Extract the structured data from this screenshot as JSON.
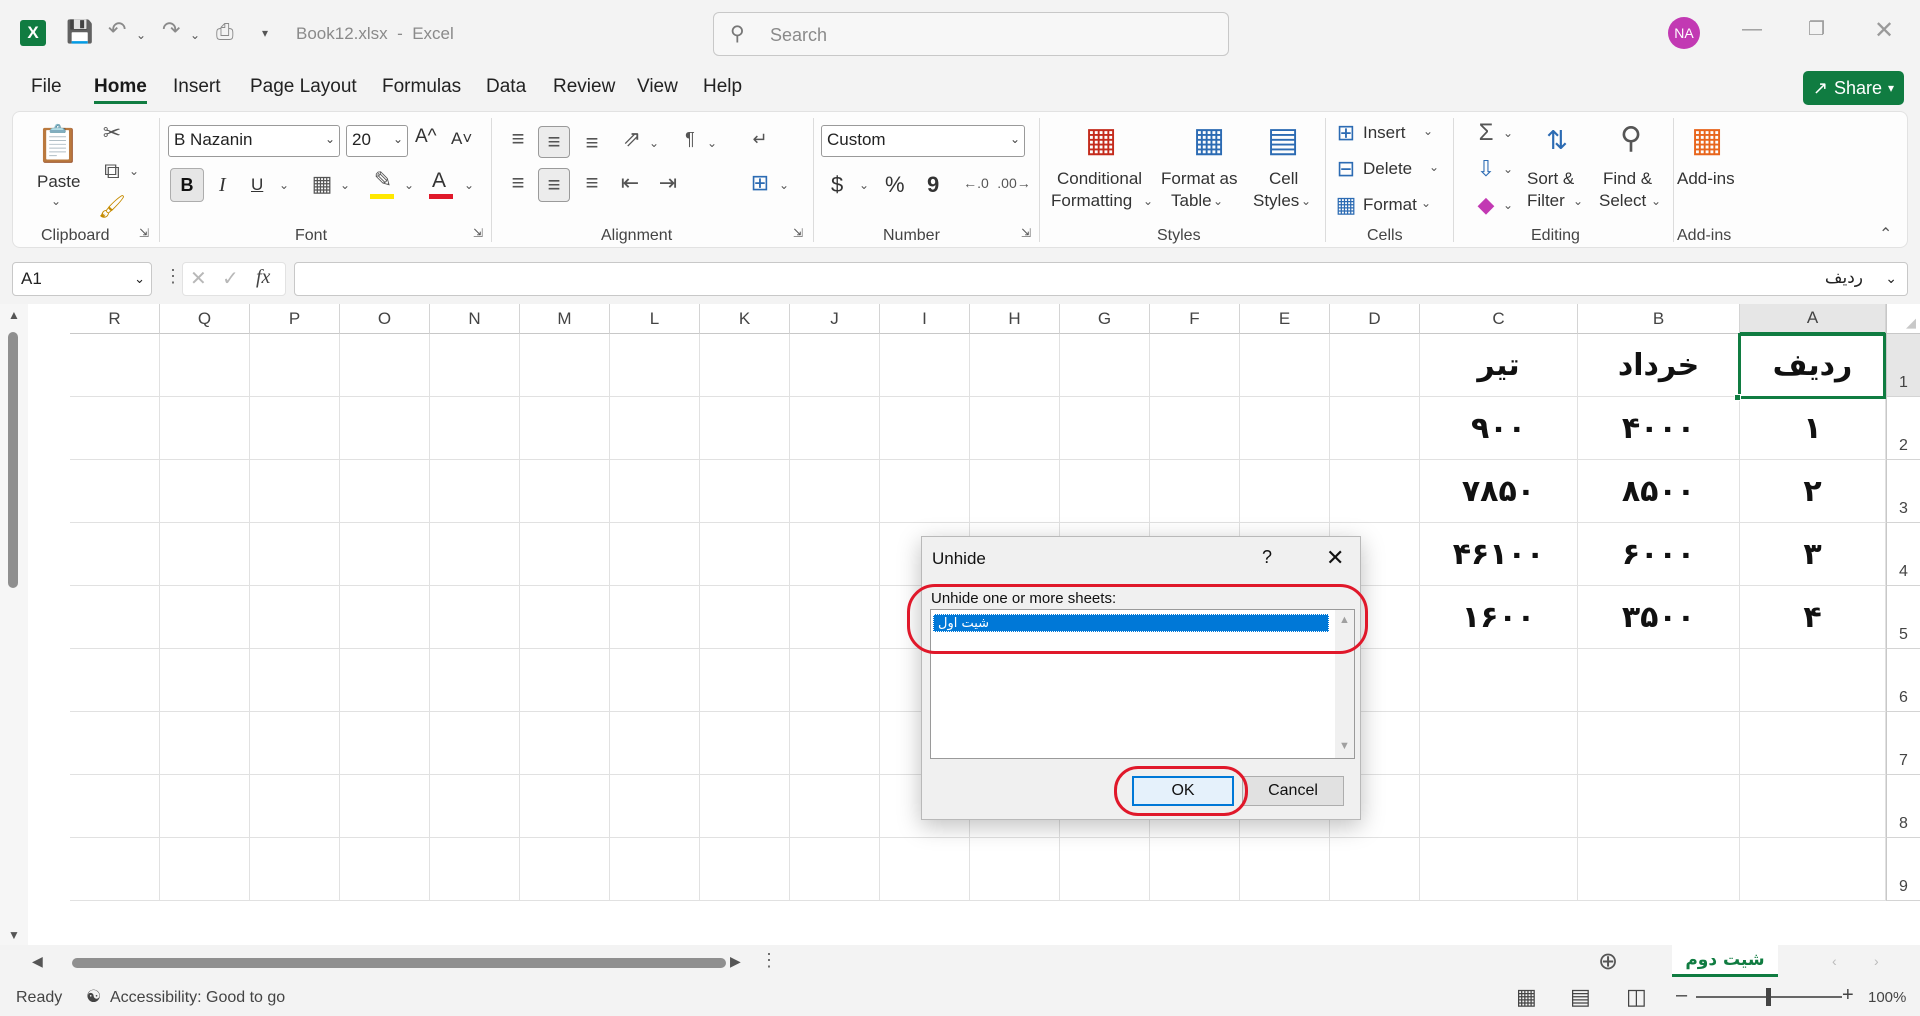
{
  "titlebar": {
    "file_title": "Book12.xlsx  -  Excel",
    "search_placeholder": "Search",
    "avatar_initials": "NA",
    "app_icon": "excel-icon"
  },
  "menu": {
    "items": [
      "File",
      "Home",
      "Insert",
      "Page Layout",
      "Formulas",
      "Data",
      "Review",
      "View",
      "Help"
    ],
    "active": "Home",
    "share_label": "Share"
  },
  "ribbon": {
    "clipboard": {
      "paste": "Paste",
      "label": "Clipboard"
    },
    "font": {
      "name": "B Nazanin",
      "size": "20",
      "label": "Font",
      "bold": "B",
      "italic": "I",
      "underline": "U",
      "grow": "A^",
      "shrink": "A˅"
    },
    "alignment": {
      "label": "Alignment"
    },
    "number": {
      "format": "Custom",
      "currency": "$",
      "percent": "%",
      "comma": "9",
      "label": "Number"
    },
    "styles": {
      "cond_fmt_1": "Conditional",
      "cond_fmt_2": "Formatting",
      "fmt_table_1": "Format as",
      "fmt_table_2": "Table",
      "cell_styles_1": "Cell",
      "cell_styles_2": "Styles",
      "label": "Styles"
    },
    "cells": {
      "insert": "Insert",
      "delete": "Delete",
      "format": "Format",
      "label": "Cells"
    },
    "editing": {
      "sort_1": "Sort &",
      "sort_2": "Filter",
      "find_1": "Find &",
      "find_2": "Select",
      "label": "Editing"
    },
    "addins": {
      "button": "Add-ins",
      "label": "Add-ins"
    }
  },
  "formula_bar": {
    "name_box": "A1",
    "fx": "fx",
    "content": "ردیف"
  },
  "grid": {
    "columns": [
      "A",
      "B",
      "C",
      "D",
      "E",
      "F",
      "G",
      "H",
      "I",
      "J",
      "K",
      "L",
      "M",
      "N",
      "O",
      "P",
      "Q",
      "R"
    ],
    "rows": [
      "1",
      "2",
      "3",
      "4",
      "5",
      "6",
      "7",
      "8",
      "9"
    ],
    "cells": {
      "A1": "ردیف",
      "B1": "خرداد",
      "C1": "تیر",
      "A2": "۱",
      "B2": "۴۰۰۰",
      "C2": "۹۰۰",
      "A3": "۲",
      "B3": "۸۵۰۰",
      "C3": "۷۸۵۰",
      "A4": "۳",
      "B4": "۶۰۰۰",
      "C4": "۴۶۱۰۰",
      "A5": "۴",
      "B5": "۳۵۰۰",
      "C5": "۱۶۰۰"
    }
  },
  "dialog": {
    "title": "Unhide",
    "help": "?",
    "prompt": "Unhide one or more sheets:",
    "sheets": [
      "شیت اول"
    ],
    "ok": "OK",
    "cancel": "Cancel"
  },
  "sheet_tabs": {
    "active": "شیت دوم",
    "add_icon": "plus-circle-icon"
  },
  "status": {
    "ready": "Ready",
    "accessibility": "Accessibility: Good to go",
    "zoom": "100%"
  },
  "colors": {
    "excel_green": "#107c41",
    "selection_blue": "#0078d7",
    "highlight_red": "#e0182a",
    "avatar_bg": "#c239b3"
  }
}
